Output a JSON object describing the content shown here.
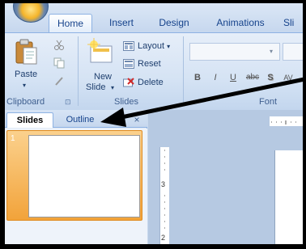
{
  "ribbon_tabs": [
    {
      "label": "Home",
      "active": true
    },
    {
      "label": "Insert",
      "active": false
    },
    {
      "label": "Design",
      "active": false
    },
    {
      "label": "Animations",
      "active": false
    },
    {
      "label": "Sli",
      "active": false
    }
  ],
  "clipboard": {
    "paste_label": "Paste",
    "group_label": "Clipboard",
    "launcher_glyph": "⊡"
  },
  "slides_group": {
    "new_slide_line1": "New",
    "new_slide_line2": "Slide",
    "dropdown_glyph": "▾",
    "layout_label": "Layout",
    "reset_label": "Reset",
    "delete_label": "Delete",
    "group_label": "Slides"
  },
  "font_group": {
    "group_label": "Font",
    "bold": "B",
    "italic": "I",
    "underline": "U",
    "strike": "abc",
    "shadow": "S",
    "spacing": "AV"
  },
  "slides_pane": {
    "tab_slides": "Slides",
    "tab_outline": "Outline",
    "close_glyph": "×",
    "thumbnail_number": "1"
  },
  "rulers": {
    "vertical_marker": "3",
    "vertical_marker2": "2"
  },
  "colors": {
    "accent": "#15428b",
    "selection": "#f2a33a",
    "arrow": "#000000"
  }
}
